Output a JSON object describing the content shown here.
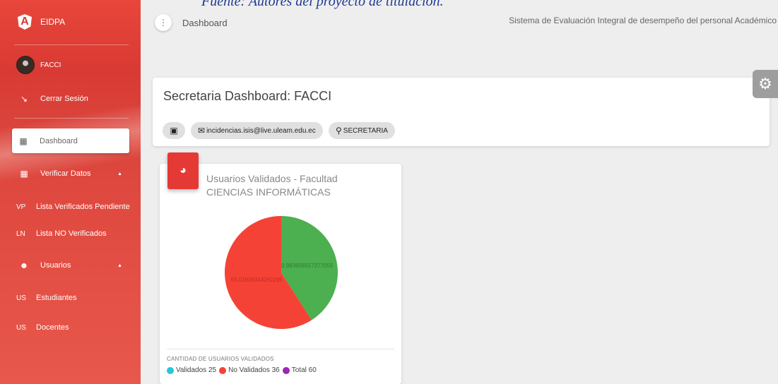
{
  "caption": "Fuente: Autores del proyecto de titulación.",
  "app": {
    "name": "EIDPA"
  },
  "user": {
    "name": "FACCI"
  },
  "sidebar": {
    "logout": "Cerrar Sesión",
    "items": [
      {
        "label": "Dashboard",
        "icon": "dashboard-icon"
      },
      {
        "label": "Verificar Datos",
        "icon": "apps-icon"
      },
      {
        "abbr": "VP",
        "label": "Lista Verificados Pendiente"
      },
      {
        "abbr": "LN",
        "label": "Lista NO Verificados"
      },
      {
        "label": "Usuarios",
        "icon": "people-icon"
      },
      {
        "abbr": "US",
        "label": "Estudiantes"
      },
      {
        "abbr": "US",
        "label": "Docentes"
      }
    ]
  },
  "topbar": {
    "title": "Dashboard",
    "system": "Sistema de Evaluación Integral de desempeño del personal Académico"
  },
  "header": {
    "title": "Secretaria Dashboard: FACCI",
    "email": "incidencias.isis@live.uleam.edu.ec",
    "role": "SECRETARIA"
  },
  "chart": {
    "title": "Usuarios Validados - Facultad CIENCIAS INFORMÁTICAS",
    "caption": "CANTIDAD DE USUARIOS VALIDADOS",
    "legend": [
      {
        "label": "Validados 25",
        "color": "#26c6da"
      },
      {
        "label": "No Validados 36",
        "color": "#f44336"
      },
      {
        "label": "Total 60",
        "color": "#9c27b0"
      }
    ]
  },
  "chart_data": {
    "type": "pie",
    "labels": [
      "40.983606557377055",
      "59.01639344262295"
    ],
    "values": [
      40.98360655737706,
      59.01639344262295
    ],
    "colors": [
      "#4caf50",
      "#f44336"
    ]
  }
}
